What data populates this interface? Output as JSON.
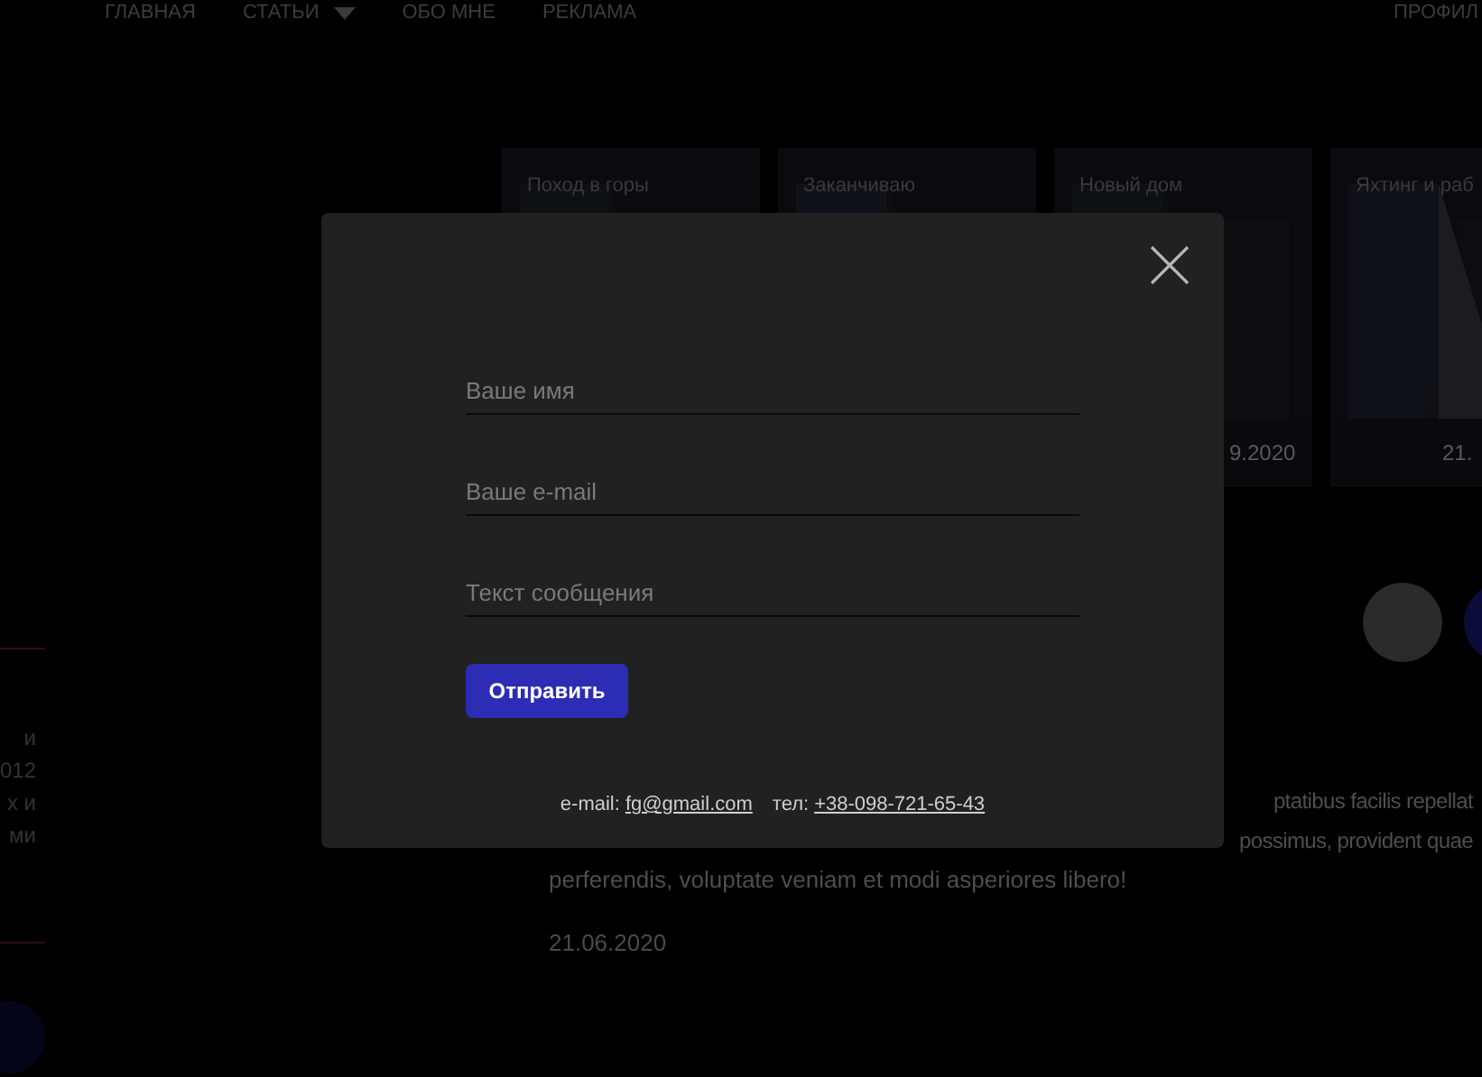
{
  "nav": {
    "items": [
      {
        "label": "ГЛАВНАЯ",
        "dropdown": false
      },
      {
        "label": "СТАТЬИ",
        "dropdown": true
      },
      {
        "label": "ОБО МНЕ",
        "dropdown": false
      },
      {
        "label": "РЕКЛАМА",
        "dropdown": false
      }
    ],
    "profile": "ПРОФИЛ"
  },
  "sidebar": {
    "text_lines": [
      "и",
      "012",
      "х и",
      "ми"
    ]
  },
  "cards": [
    {
      "title": "Поход в горы"
    },
    {
      "title": "Заканчиваю"
    },
    {
      "title": "Новый дом",
      "date": "9.2020"
    },
    {
      "title": "Яхтинг и раб",
      "date": "21."
    }
  ],
  "article": {
    "lines": [
      "ptatibus facilis repellat",
      "possimus, provident quae",
      "perferendis, voluptate veniam et modi asperiores libero!"
    ],
    "date": "21.06.2020"
  },
  "modal": {
    "fields": [
      {
        "placeholder": "Ваше имя"
      },
      {
        "placeholder": "Ваше e-mail"
      },
      {
        "placeholder": "Текст сообщения"
      }
    ],
    "submit": "Отправить",
    "contacts": {
      "email_label": "e-mail:",
      "email": "fg@gmail.com",
      "phone_label": "тел:",
      "phone": "+38-098-721-65-43"
    }
  }
}
